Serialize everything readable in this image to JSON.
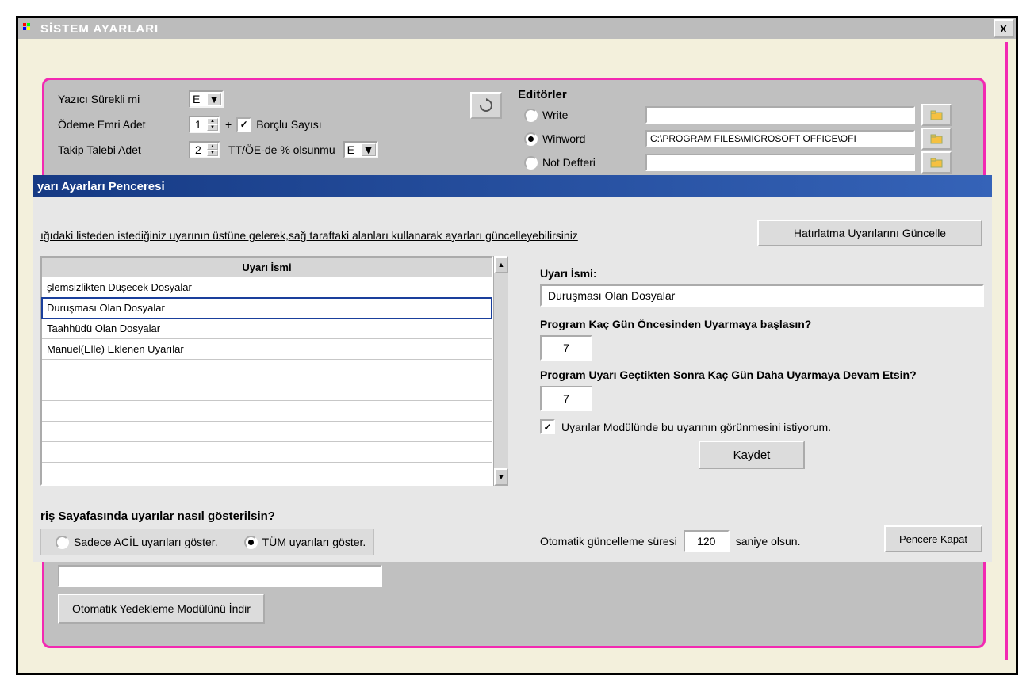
{
  "window": {
    "title": "SİSTEM AYARLARI",
    "close_x": "X"
  },
  "settings": {
    "printer_label": "Yazıcı Sürekli mi",
    "printer_value": "E",
    "payment_order_label": "Ödeme Emri Adet",
    "payment_order_value": "1",
    "plus": "+",
    "debtor_count_label": "Borçlu Sayısı",
    "followup_label": "Takip Talebi Adet",
    "followup_value": "2",
    "tt_oe_label": "TT/ÖE-de % olsunmu",
    "tt_oe_value": "E"
  },
  "editors": {
    "title": "Editörler",
    "write": "Write",
    "winword": "Winword",
    "notepad": "Not Defteri",
    "write_path": "",
    "winword_path": "C:\\PROGRAM FILES\\MICROSOFT OFFICE\\OFI",
    "notepad_path": ""
  },
  "dialog": {
    "title": "yarı Ayarları Penceresi",
    "info": "ığıdaki listeden istediğiniz uyarının üstüne gelerek,sağ taraftaki alanları kullanarak ayarları güncelleyebilirsiniz",
    "update_btn": "Hatırlatma Uyarılarını Güncelle",
    "list_header": "Uyarı İsmi",
    "list_items": [
      "şlemsizlikten Düşecek Dosyalar",
      "Duruşması Olan Dosyalar",
      "Taahhüdü Olan Dosyalar",
      "Manuel(Elle) Eklenen Uyarılar"
    ],
    "selected_index": 1,
    "right": {
      "name_label": "Uyarı İsmi:",
      "name_value": "Duruşması Olan Dosyalar",
      "q1": "Program Kaç Gün Öncesinden Uyarmaya başlasın?",
      "q1_value": "7",
      "q2": "Program Uyarı Geçtikten Sonra Kaç Gün Daha Uyarmaya Devam Etsin?",
      "q2_value": "7",
      "cb_label": "Uyarılar Modülünde bu uyarının görünmesini istiyorum.",
      "save": "Kaydet"
    },
    "how_show_title": "riş Sayafasında uyarılar nasıl gösterilsin?",
    "show_urgent": "Sadece ACİL uyarıları göster.",
    "show_all": "TÜM uyarıları göster.",
    "auto_label_before": "Otomatik güncelleme süresi",
    "auto_value": "120",
    "auto_label_after": "saniye olsun.",
    "close": "Pencere Kapat"
  },
  "bottom": {
    "download_btn": "Otomatik Yedekleme Modülünü İndir"
  }
}
